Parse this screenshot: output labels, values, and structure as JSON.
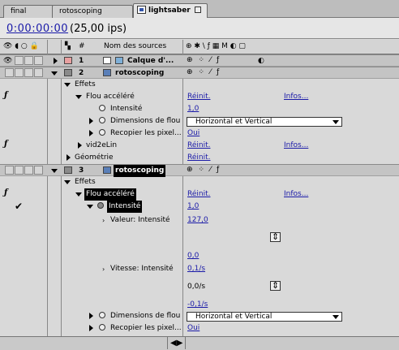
{
  "tabs": [
    {
      "label": "final",
      "active": false
    },
    {
      "label": "rotoscoping",
      "active": false
    },
    {
      "label": "lightsaber",
      "active": true
    }
  ],
  "time": {
    "timecode": "0:00:00:00",
    "fps": "(25,00 ips)"
  },
  "header": {
    "hash": "#",
    "source_name": "Nom des sources",
    "switch_icons": "⊕ ✱ \\ ƒ ▦ M ◐ ▢"
  },
  "layers": [
    {
      "num": "1",
      "name": "Calque d'...",
      "color": "#e8a0a0"
    },
    {
      "num": "2",
      "name": "rotoscoping",
      "color": "#8a8a8a"
    },
    {
      "num": "3",
      "name": "rotoscoping",
      "color": "#8a8a8a"
    }
  ],
  "labels": {
    "effets": "Effets",
    "flou": "Flou accéléré",
    "intensite": "Intensité",
    "dimensions": "Dimensions de flou",
    "recopier": "Recopier les pixel...",
    "vid2elin": "vid2eLin",
    "geometrie": "Géométrie",
    "valeur": "Valeur: Intensité",
    "vitesse": "Vitesse: Intensité",
    "reinit": "Réinit.",
    "infos": "Infos..."
  },
  "values": {
    "intensite_1": "1,0",
    "dimensions_1": "Horizontal et Vertical",
    "recopier_1": "Oui",
    "intensite_2": "1,0",
    "valeur_max": "127,0",
    "valeur_min": "0,0",
    "vitesse_max": "0,1/s",
    "vitesse_cur": "0,0/s",
    "vitesse_min": "-0,1/s",
    "dimensions_2": "Horizontal et Vertical",
    "recopier_2": "Oui"
  },
  "colors": {
    "link": "#1a1aa8",
    "selection": "#000000"
  }
}
